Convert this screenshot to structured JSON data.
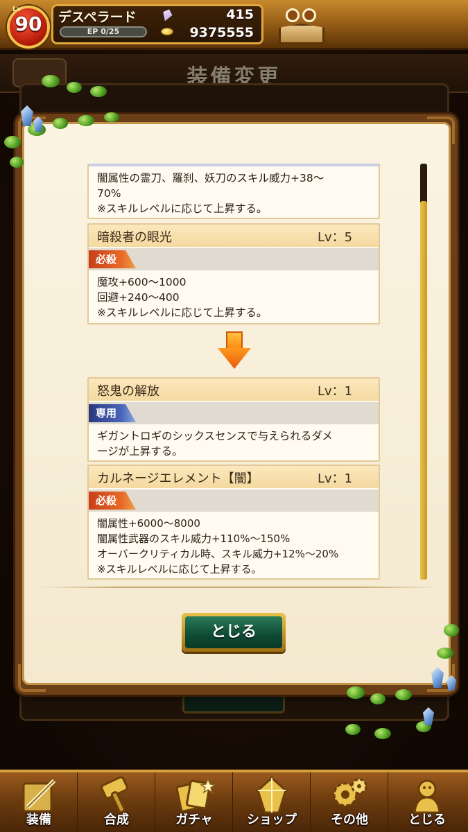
{
  "status": {
    "level_caption": "Lv",
    "level": "90",
    "player_name": "デスペラード",
    "ep": "EP 0/25",
    "gems": "415",
    "gold": "9375555"
  },
  "background": {
    "screen_title": "装備変更"
  },
  "modal": {
    "cards": [
      {
        "desc": [
          "闇属性の霊刀、羅刹、妖刀のスキル威力+38～",
          "70%",
          "※スキルレベルに応じて上昇する。"
        ]
      },
      {
        "name": "暗殺者の眼光",
        "lv": "Lv：5",
        "tag": "必殺",
        "desc": [
          "魔攻+600～1000",
          "回避+240～400",
          "※スキルレベルに応じて上昇する。"
        ]
      },
      {
        "name": "怒鬼の解放",
        "lv": "Lv：1",
        "tag": "専用",
        "desc": [
          "ギガントロギのシックスセンスで与えられるダメ",
          "ージが上昇する。"
        ]
      },
      {
        "name": "カルネージエレメント【闇】",
        "lv": "Lv：1",
        "tag": "必殺",
        "desc": [
          "闇属性+6000～8000",
          "闇属性武器のスキル威力+110%～150%",
          "オーバークリティカル時、スキル威力+12%～20%",
          "※スキルレベルに応じて上昇する。"
        ]
      }
    ],
    "close_label": "とじる"
  },
  "nav": {
    "items": [
      {
        "label": "装備",
        "icon": "equipment-icon"
      },
      {
        "label": "合成",
        "icon": "hammer-icon"
      },
      {
        "label": "ガチャ",
        "icon": "gacha-cards-icon"
      },
      {
        "label": "ショップ",
        "icon": "shop-crystal-icon"
      },
      {
        "label": "その他",
        "icon": "gears-icon"
      },
      {
        "label": "とじる",
        "icon": "close-menu-icon"
      }
    ]
  },
  "colors": {
    "accent_gold": "#e0a83c",
    "tag_red": "#c8401a",
    "tag_blue": "#2a3880",
    "close_button_green": "#0e4a34"
  }
}
